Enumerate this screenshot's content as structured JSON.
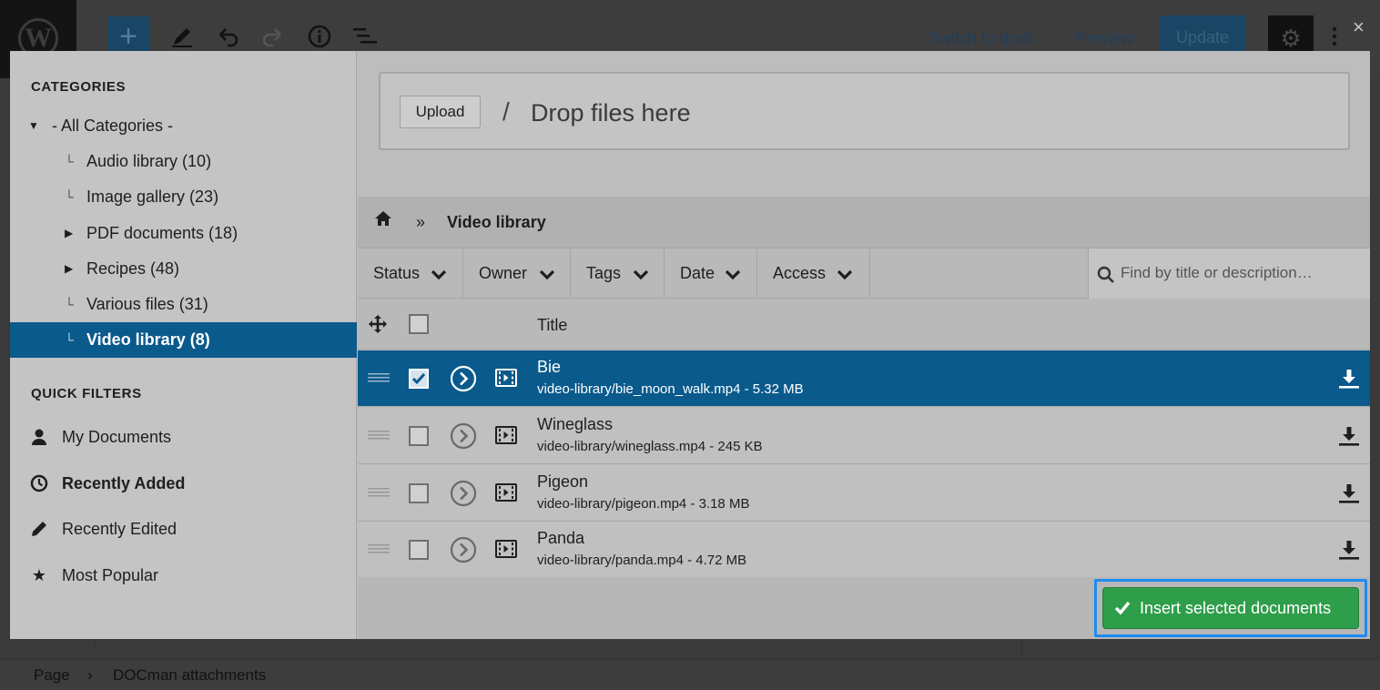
{
  "wp": {
    "switch_to_draft": "Switch to draft",
    "preview": "Preview",
    "update": "Update",
    "close": "×",
    "add": "+",
    "breadcrumb_page": "Page",
    "breadcrumb_sep": "›",
    "breadcrumb_block": "DOCman attachments"
  },
  "sidebar": {
    "categories_title": "CATEGORIES",
    "all_categories": "- All Categories -",
    "categories": [
      {
        "label": "Audio library (10)",
        "expandable": false
      },
      {
        "label": "Image gallery (23)",
        "expandable": false
      },
      {
        "label": "PDF documents (18)",
        "expandable": true
      },
      {
        "label": "Recipes (48)",
        "expandable": true
      },
      {
        "label": "Various files (31)",
        "expandable": false
      },
      {
        "label": "Video library (8)",
        "expandable": false,
        "active": true
      }
    ],
    "quick_filters_title": "QUICK FILTERS",
    "quick_filters": [
      {
        "label": "My Documents",
        "icon": "user-icon"
      },
      {
        "label": "Recently Added",
        "icon": "clock-icon",
        "active": true
      },
      {
        "label": "Recently Edited",
        "icon": "pencil-icon"
      },
      {
        "label": "Most Popular",
        "icon": "star-icon"
      }
    ]
  },
  "upload": {
    "button": "Upload",
    "separator": "/",
    "drop_text": "Drop files here"
  },
  "breadcrumb": {
    "separator": "»",
    "current": "Video library"
  },
  "filters": {
    "items": [
      "Status",
      "Owner",
      "Tags",
      "Date",
      "Access"
    ],
    "search_placeholder": "Find by title or description…"
  },
  "table": {
    "title_header": "Title",
    "rows": [
      {
        "title": "Bie",
        "file": "video-library/bie_moon_walk.mp4 - 5.32 MB",
        "selected": true
      },
      {
        "title": "Wineglass",
        "file": "video-library/wineglass.mp4 - 245 KB",
        "selected": false
      },
      {
        "title": "Pigeon",
        "file": "video-library/pigeon.mp4 - 3.18 MB",
        "selected": false
      },
      {
        "title": "Panda",
        "file": "video-library/panda.mp4 - 4.72 MB",
        "selected": false
      }
    ]
  },
  "footer": {
    "insert_button": "Insert selected documents"
  },
  "colors": {
    "selected_blue": "#0a5a8c",
    "insert_green": "#2e9e4a",
    "focus_ring": "#1e8cf0"
  }
}
